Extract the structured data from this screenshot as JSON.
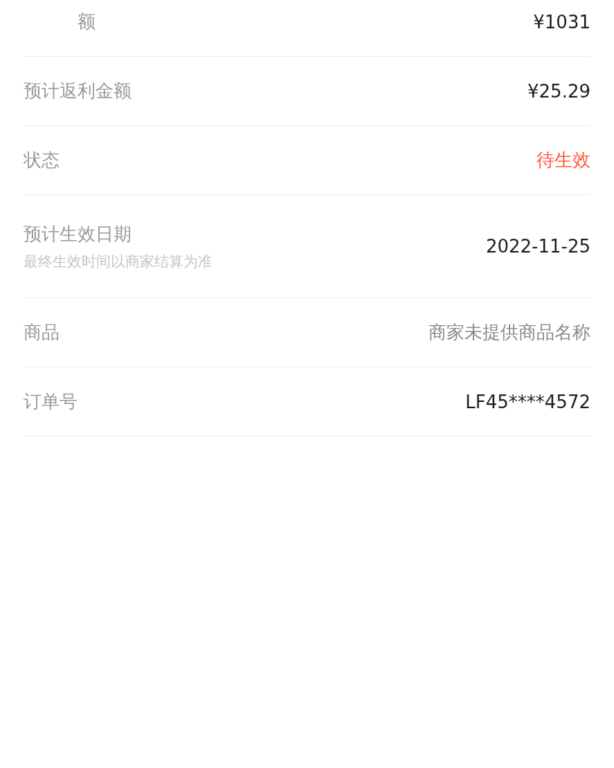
{
  "rows": [
    {
      "label": "额",
      "label_partial": true,
      "value": "¥1031",
      "kind": "plain"
    },
    {
      "label": "预计返利金额",
      "label_partial": false,
      "value": "¥25.29",
      "kind": "plain"
    },
    {
      "label": "状态",
      "label_partial": false,
      "value": "待生效",
      "kind": "status"
    },
    {
      "label": "预计生效日期",
      "label_partial": false,
      "note": "最终生效时间以商家结算为准",
      "value": "2022-11-25",
      "kind": "plain"
    },
    {
      "label": "商品",
      "label_partial": false,
      "value": "商家未提供商品名称",
      "kind": "muted"
    },
    {
      "label": "订单号",
      "label_partial": false,
      "value": "LF45****4572",
      "kind": "plain"
    }
  ]
}
